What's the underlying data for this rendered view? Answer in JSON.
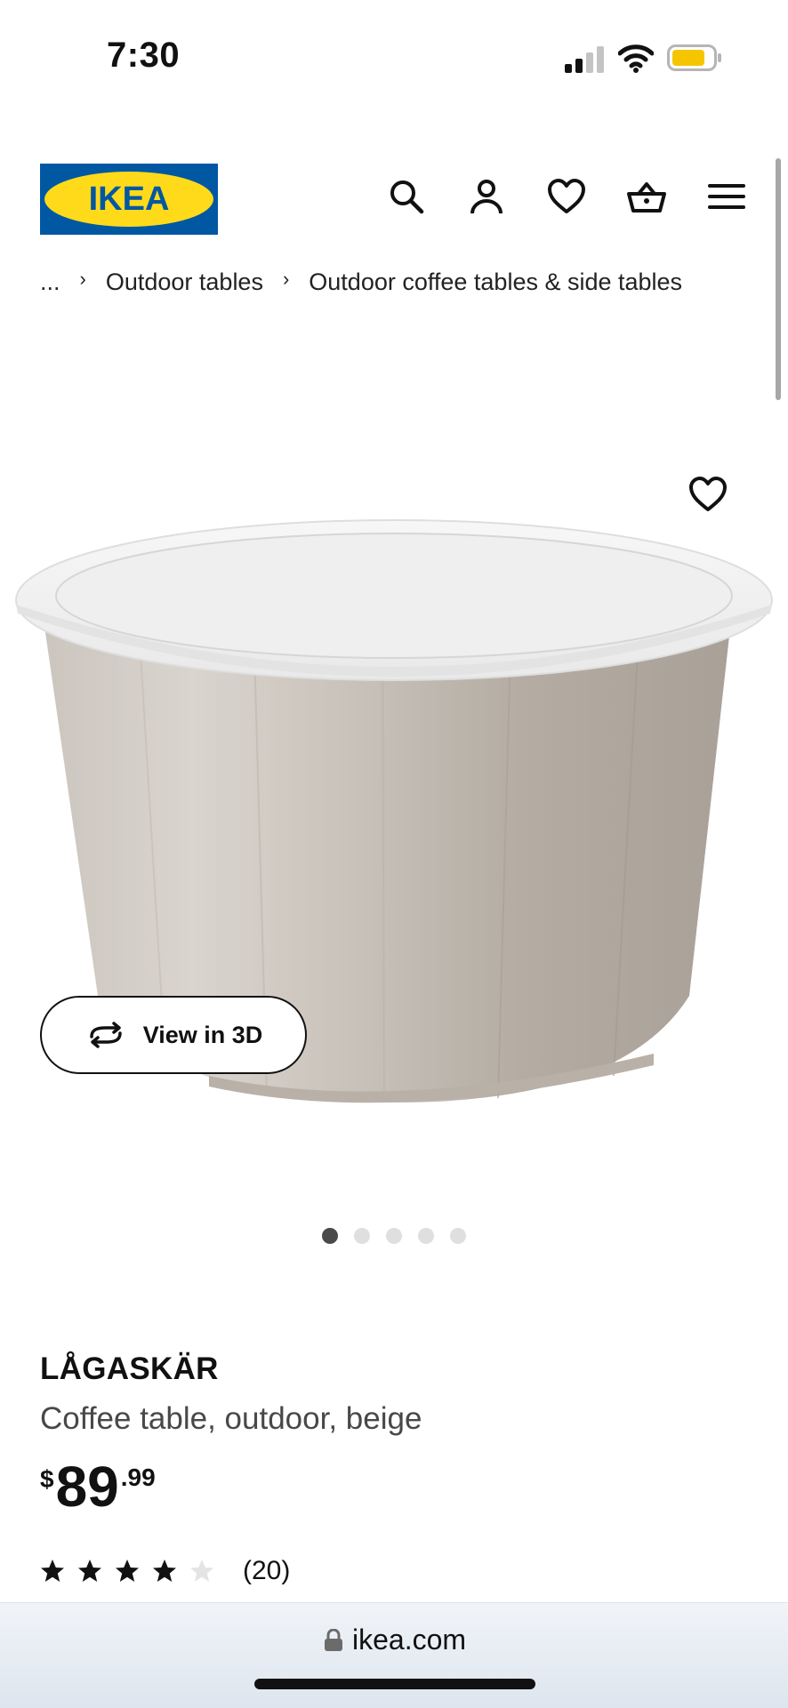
{
  "status_bar": {
    "time": "7:30",
    "icons": [
      "cellular-signal-icon",
      "wifi-icon",
      "battery-icon"
    ],
    "battery_color": "#f5c500"
  },
  "header": {
    "logo_text": "IKEA",
    "brand_colors": {
      "blue": "#0058a3",
      "yellow": "#ffda1a"
    },
    "icons": [
      "search-icon",
      "account-icon",
      "heart-icon",
      "cart-icon",
      "menu-icon"
    ]
  },
  "breadcrumb": {
    "ellipsis": "...",
    "items": [
      "Outdoor tables",
      "Outdoor coffee tables & side tables"
    ]
  },
  "gallery": {
    "view_3d_label": "View in 3D",
    "dot_count": 5,
    "active_dot": 0
  },
  "product": {
    "name": "LÅGASKÄR",
    "description": "Coffee table, outdoor, beige",
    "price": {
      "currency": "$",
      "integer": "89",
      "decimal": ".99"
    },
    "rating": {
      "value": 4,
      "max": 5,
      "count": "(20)"
    }
  },
  "browser": {
    "url": "ikea.com"
  }
}
